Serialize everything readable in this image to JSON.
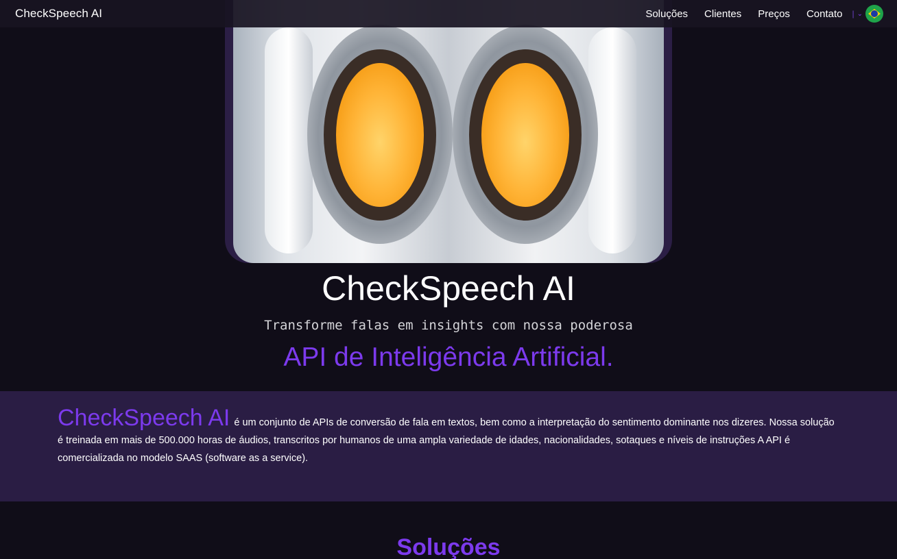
{
  "nav": {
    "brand": "CheckSpeech AI",
    "links": [
      "Soluções",
      "Clientes",
      "Preços",
      "Contato"
    ],
    "lang_separator": "|",
    "lang_chevron": "⌄"
  },
  "hero": {
    "title": "CheckSpeech AI",
    "subtitle": "Transforme falas em insights com nossa poderosa",
    "accent": "API de Inteligência Artificial."
  },
  "about": {
    "brand": "CheckSpeech AI",
    "text": "é um conjunto de APIs de conversão de fala em textos, bem como a interpretação do sentimento dominante nos dizeres. Nossa solução é treinada em mais de 500.000 horas de áudios, transcritos por humanos de uma ampla variedade de idades, nacionalidades, sotaques e níveis de instruções A API é comercializada no modelo SAAS (software as a service)."
  },
  "solutions": {
    "title": "Soluções"
  },
  "colors": {
    "background": "#100d18",
    "accent": "#7c3aed",
    "band": "#2a1d44"
  },
  "icons": {
    "language": "brazil-flag-icon"
  }
}
